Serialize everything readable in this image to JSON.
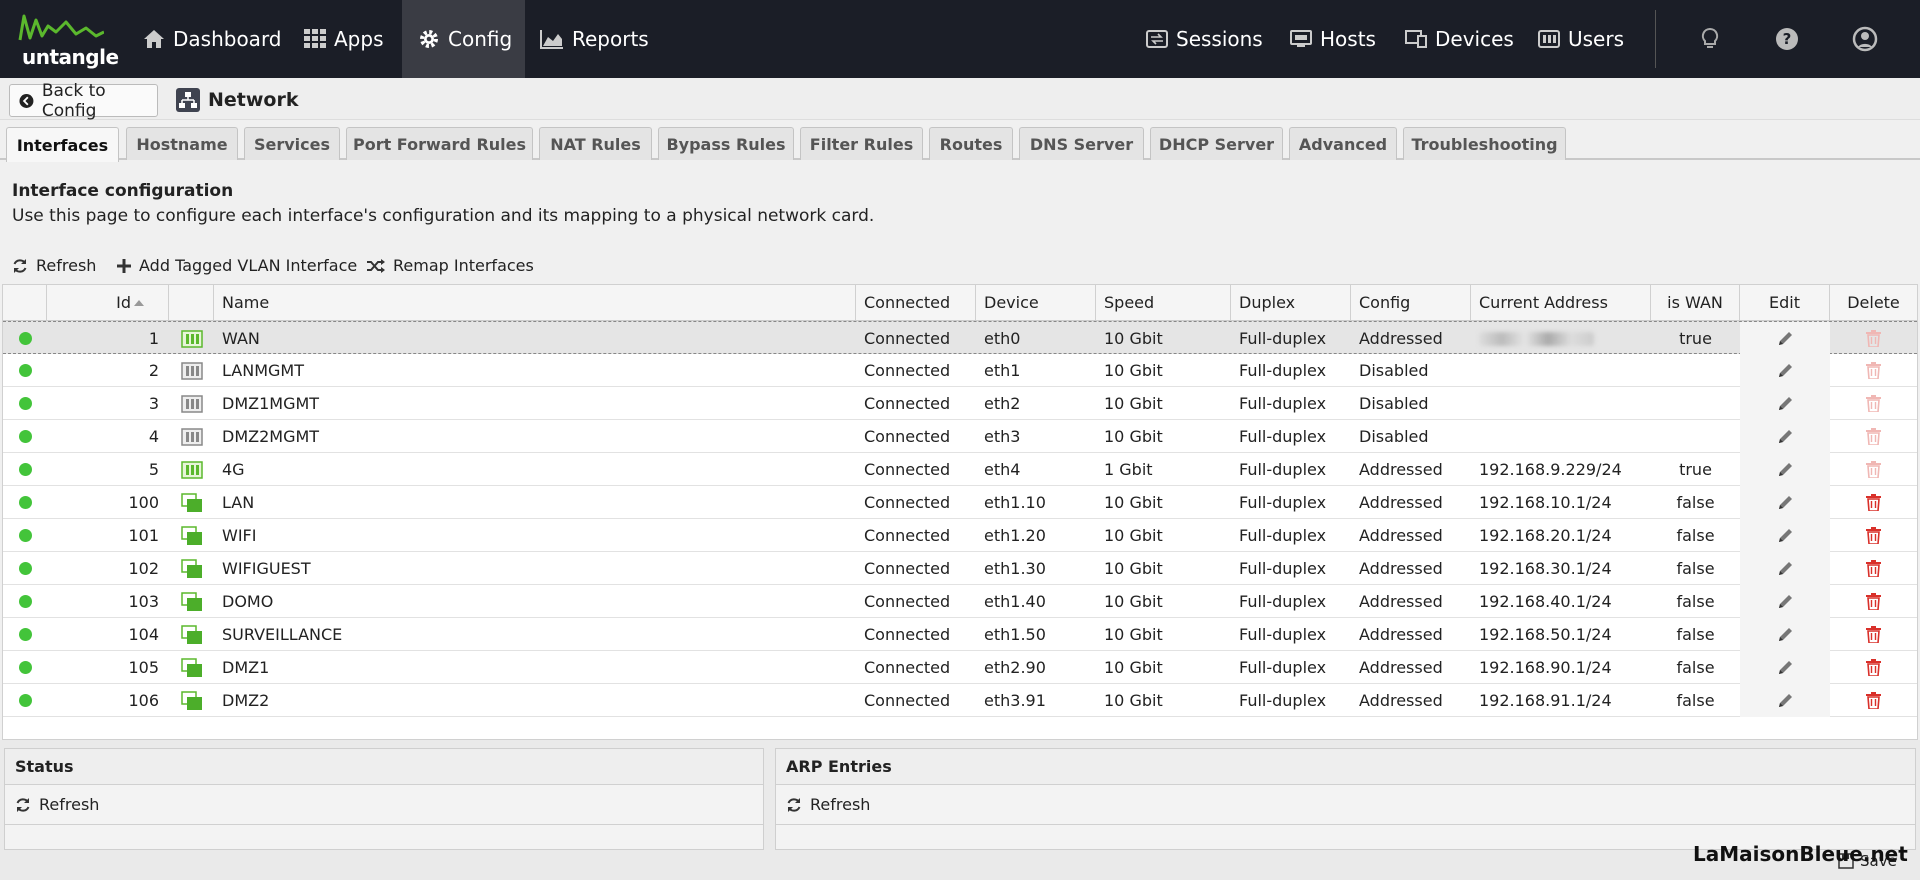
{
  "brand": {
    "logo_text": "untangle"
  },
  "nav": {
    "left": [
      {
        "label": "Dashboard",
        "icon": "home-icon"
      },
      {
        "label": "Apps",
        "icon": "grid-icon"
      },
      {
        "label": "Config",
        "icon": "gear-icon",
        "active": true
      },
      {
        "label": "Reports",
        "icon": "area-chart-icon"
      }
    ],
    "right": [
      {
        "label": "Sessions",
        "icon": "sessions-icon"
      },
      {
        "label": "Hosts",
        "icon": "hosts-icon"
      },
      {
        "label": "Devices",
        "icon": "devices-icon"
      },
      {
        "label": "Users",
        "icon": "users-icon"
      }
    ],
    "icons": [
      "lightbulb-icon",
      "help-icon",
      "account-icon"
    ]
  },
  "subbar": {
    "back_label": "Back to Config",
    "title": "Network"
  },
  "tabs": [
    "Interfaces",
    "Hostname",
    "Services",
    "Port Forward Rules",
    "NAT Rules",
    "Bypass Rules",
    "Filter Rules",
    "Routes",
    "DNS Server",
    "DHCP Server",
    "Advanced",
    "Troubleshooting"
  ],
  "active_tab": "Interfaces",
  "panel": {
    "title": "Interface configuration",
    "description": "Use this page to configure each interface's configuration and its mapping to a physical network card."
  },
  "toolbar": {
    "refresh": "Refresh",
    "add_vlan": "Add Tagged VLAN Interface",
    "remap": "Remap Interfaces"
  },
  "grid": {
    "columns": [
      "Id",
      "Name",
      "Connected",
      "Device",
      "Speed",
      "Duplex",
      "Config",
      "Current Address",
      "is WAN",
      "Edit",
      "Delete"
    ],
    "sort_column": "Id",
    "rows": [
      {
        "id": "1",
        "name": "WAN",
        "connected": "Connected",
        "device": "eth0",
        "speed": "10 Gbit",
        "duplex": "Full-duplex",
        "config": "Addressed",
        "address": "",
        "address_redacted": true,
        "is_wan": "true",
        "icon": "wan",
        "delete_enabled": false
      },
      {
        "id": "2",
        "name": "LANMGMT",
        "connected": "Connected",
        "device": "eth1",
        "speed": "10 Gbit",
        "duplex": "Full-duplex",
        "config": "Disabled",
        "address": "",
        "is_wan": "",
        "icon": "disabled",
        "delete_enabled": false
      },
      {
        "id": "3",
        "name": "DMZ1MGMT",
        "connected": "Connected",
        "device": "eth2",
        "speed": "10 Gbit",
        "duplex": "Full-duplex",
        "config": "Disabled",
        "address": "",
        "is_wan": "",
        "icon": "disabled",
        "delete_enabled": false
      },
      {
        "id": "4",
        "name": "DMZ2MGMT",
        "connected": "Connected",
        "device": "eth3",
        "speed": "10 Gbit",
        "duplex": "Full-duplex",
        "config": "Disabled",
        "address": "",
        "is_wan": "",
        "icon": "disabled",
        "delete_enabled": false
      },
      {
        "id": "5",
        "name": "4G",
        "connected": "Connected",
        "device": "eth4",
        "speed": "1 Gbit",
        "duplex": "Full-duplex",
        "config": "Addressed",
        "address": "192.168.9.229/24",
        "is_wan": "true",
        "icon": "wan",
        "delete_enabled": false
      },
      {
        "id": "100",
        "name": "LAN",
        "connected": "Connected",
        "device": "eth1.10",
        "speed": "10 Gbit",
        "duplex": "Full-duplex",
        "config": "Addressed",
        "address": "192.168.10.1/24",
        "is_wan": "false",
        "icon": "vlan",
        "delete_enabled": true
      },
      {
        "id": "101",
        "name": "WIFI",
        "connected": "Connected",
        "device": "eth1.20",
        "speed": "10 Gbit",
        "duplex": "Full-duplex",
        "config": "Addressed",
        "address": "192.168.20.1/24",
        "is_wan": "false",
        "icon": "vlan",
        "delete_enabled": true
      },
      {
        "id": "102",
        "name": "WIFIGUEST",
        "connected": "Connected",
        "device": "eth1.30",
        "speed": "10 Gbit",
        "duplex": "Full-duplex",
        "config": "Addressed",
        "address": "192.168.30.1/24",
        "is_wan": "false",
        "icon": "vlan",
        "delete_enabled": true
      },
      {
        "id": "103",
        "name": "DOMO",
        "connected": "Connected",
        "device": "eth1.40",
        "speed": "10 Gbit",
        "duplex": "Full-duplex",
        "config": "Addressed",
        "address": "192.168.40.1/24",
        "is_wan": "false",
        "icon": "vlan",
        "delete_enabled": true
      },
      {
        "id": "104",
        "name": "SURVEILLANCE",
        "connected": "Connected",
        "device": "eth1.50",
        "speed": "10 Gbit",
        "duplex": "Full-duplex",
        "config": "Addressed",
        "address": "192.168.50.1/24",
        "is_wan": "false",
        "icon": "vlan",
        "delete_enabled": true
      },
      {
        "id": "105",
        "name": "DMZ1",
        "connected": "Connected",
        "device": "eth2.90",
        "speed": "10 Gbit",
        "duplex": "Full-duplex",
        "config": "Addressed",
        "address": "192.168.90.1/24",
        "is_wan": "false",
        "icon": "vlan",
        "delete_enabled": true
      },
      {
        "id": "106",
        "name": "DMZ2",
        "connected": "Connected",
        "device": "eth3.91",
        "speed": "10 Gbit",
        "duplex": "Full-duplex",
        "config": "Addressed",
        "address": "192.168.91.1/24",
        "is_wan": "false",
        "icon": "vlan",
        "delete_enabled": true
      }
    ]
  },
  "status_panel": {
    "title": "Status",
    "refresh": "Refresh"
  },
  "arp_panel": {
    "title": "ARP Entries",
    "refresh": "Refresh"
  },
  "watermark": "LaMaisonBleue.net",
  "save_label": "Save",
  "colors": {
    "topbar": "#1b1e27",
    "logo_green": "#5bb82d",
    "status_green": "#43c43a",
    "delete_red": "#d9302a",
    "delete_disabled": "#f0b7b4"
  }
}
